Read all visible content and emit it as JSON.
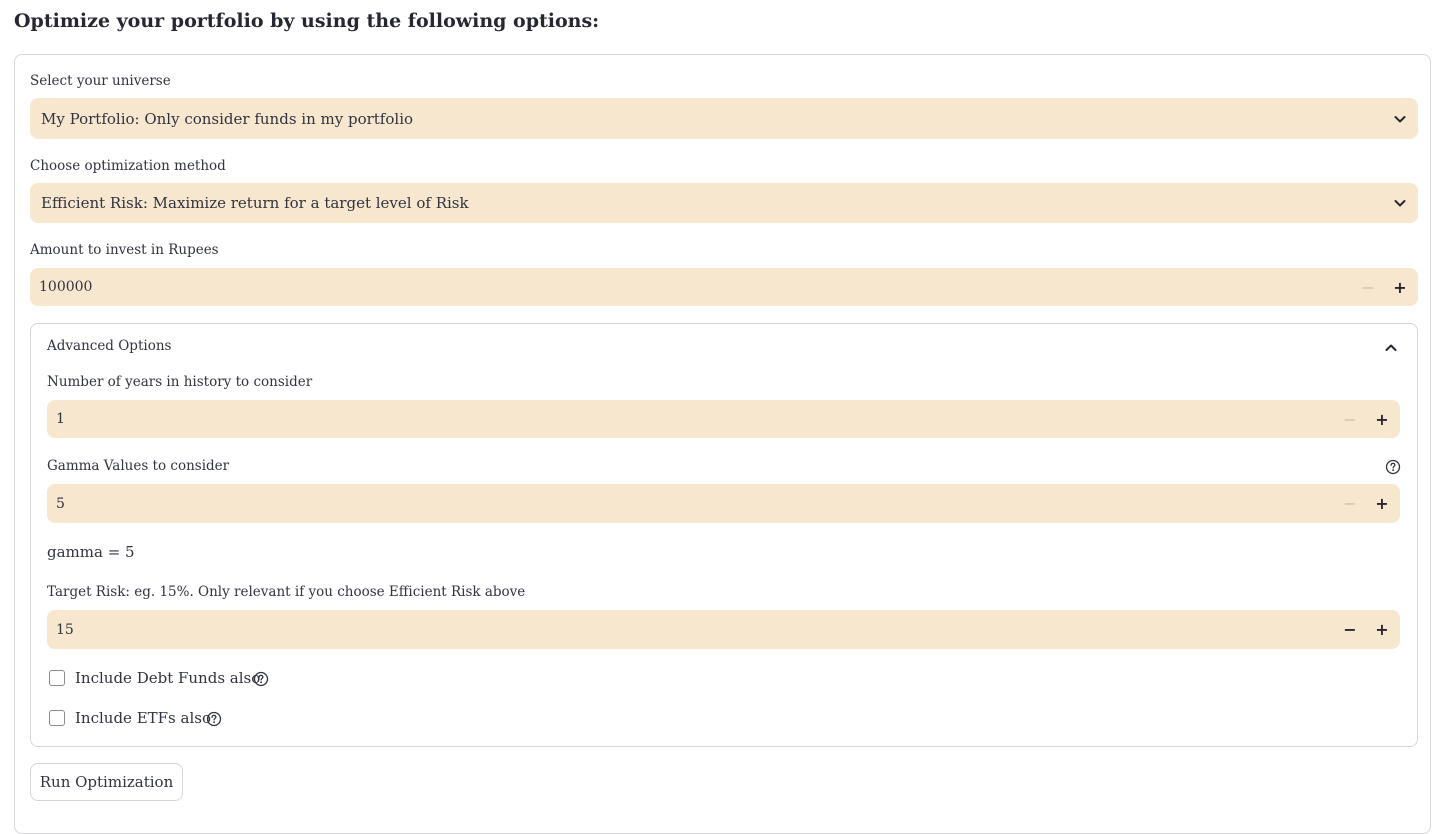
{
  "page": {
    "title": "Optimize your portfolio by using the following options:"
  },
  "universe": {
    "label": "Select your universe",
    "selected": "My Portfolio: Only consider funds in my portfolio",
    "icon": "chevron-down-icon"
  },
  "method": {
    "label": "Choose optimization method",
    "selected": "Efficient Risk: Maximize return for a target level of Risk",
    "icon": "chevron-down-icon"
  },
  "amount": {
    "label": "Amount to invest in Rupees",
    "value": "100000",
    "minus": "−",
    "plus": "+"
  },
  "advanced": {
    "title": "Advanced Options",
    "toggle_icon": "chevron-up-icon",
    "years": {
      "label": "Number of years in history to consider",
      "value": "1",
      "minus": "−",
      "plus": "+"
    },
    "gamma": {
      "label": "Gamma Values to consider",
      "value": "5",
      "minus": "−",
      "plus": "+",
      "help_icon": "help-circle-icon"
    },
    "gamma_text": "gamma = 5",
    "target_risk": {
      "label": "Target Risk: eg. 15%. Only relevant if you choose Efficient Risk above",
      "value": "15",
      "minus": "−",
      "plus": "+"
    },
    "debt_funds": {
      "label": "Include Debt Funds also",
      "checked": false,
      "help_icon": "help-circle-icon"
    },
    "etfs": {
      "label": "Include ETFs also",
      "checked": false,
      "help_icon": "help-circle-icon"
    }
  },
  "run_button": {
    "label": "Run Optimization"
  },
  "colors": {
    "input_bg": "#f7e7cf",
    "border": "#d6d6d9",
    "text": "#31333f"
  }
}
